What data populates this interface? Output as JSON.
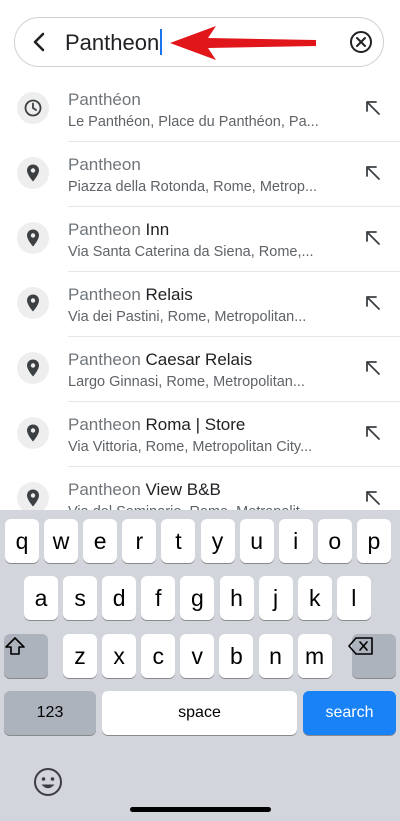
{
  "search": {
    "query": "Pantheon"
  },
  "results": [
    {
      "icon": "clock-icon",
      "match": "Panthéon",
      "rest": "",
      "subtitle": "Le Panthéon, Place du Panthéon, Pa..."
    },
    {
      "icon": "location-pin-icon",
      "match": "Pantheon",
      "rest": "",
      "subtitle": "Piazza della Rotonda, Rome, Metrop..."
    },
    {
      "icon": "location-pin-icon",
      "match": "Pantheon ",
      "rest": "Inn",
      "subtitle": "Via Santa Caterina da Siena, Rome,..."
    },
    {
      "icon": "location-pin-icon",
      "match": "Pantheon ",
      "rest": "Relais",
      "subtitle": "Via dei Pastini, Rome, Metropolitan..."
    },
    {
      "icon": "location-pin-icon",
      "match": "Pantheon ",
      "rest": "Caesar Relais",
      "subtitle": "Largo Ginnasi, Rome, Metropolitan..."
    },
    {
      "icon": "location-pin-icon",
      "match": "Pantheon ",
      "rest": "Roma | Store",
      "subtitle": "Via Vittoria, Rome, Metropolitan City..."
    },
    {
      "icon": "location-pin-icon",
      "match": "Pantheon ",
      "rest": "View B&B",
      "subtitle": "Via del Seminario, Rome, Metropolit..."
    }
  ],
  "keyboard": {
    "row1": [
      "q",
      "w",
      "e",
      "r",
      "t",
      "y",
      "u",
      "i",
      "o",
      "p"
    ],
    "row2": [
      "a",
      "s",
      "d",
      "f",
      "g",
      "h",
      "j",
      "k",
      "l"
    ],
    "row3": [
      "z",
      "x",
      "c",
      "v",
      "b",
      "n",
      "m"
    ],
    "numbers_label": "123",
    "space_label": "space",
    "search_label": "search",
    "accent_color": "#1a82f7"
  }
}
